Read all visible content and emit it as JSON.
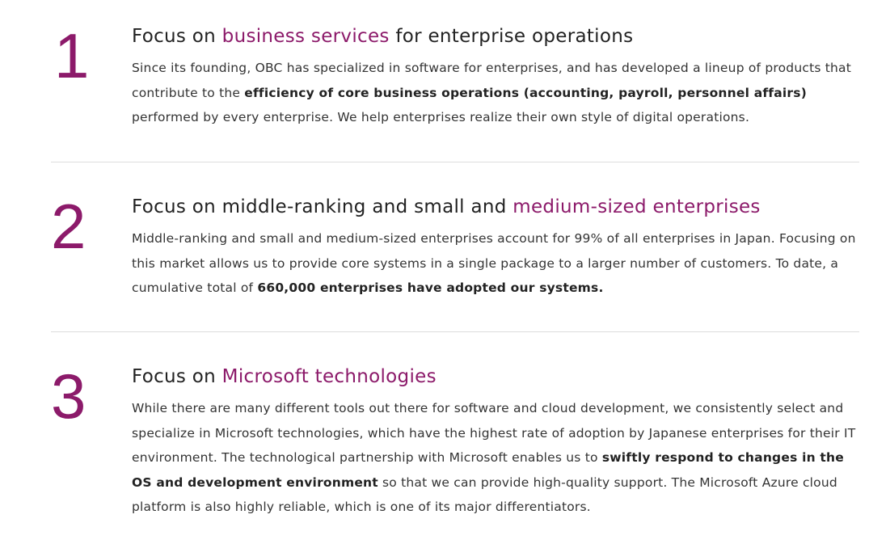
{
  "points": [
    {
      "number": "1",
      "title_pre": "Focus on ",
      "title_accent": "business services",
      "title_post": " for enterprise operations",
      "body_1": "Since its founding, OBC has specialized in software for enterprises, and has developed a lineup of products that contribute to the ",
      "body_bold_1": "efficiency of core business operations (accounting, payroll, personnel affairs)",
      "body_2": " performed by every enterprise. We help enterprises realize their own style of digital operations."
    },
    {
      "number": "2",
      "title_pre": "Focus on middle-ranking and small and ",
      "title_accent": "medium-sized enterprises",
      "body_1": "Middle-ranking and small and medium-sized enterprises account for 99% of all enterprises in Japan. Focusing on this market allows us to provide core systems in a single package to a larger number of customers. To date, a cumulative total of ",
      "body_bold_1": "660,000 enterprises have adopted our systems."
    },
    {
      "number": "3",
      "title_pre": "Focus on ",
      "title_accent": "Microsoft technologies",
      "body_1": "While there are many different tools out there for software and cloud development, we consistently select and specialize in Microsoft technologies, which have the highest rate of adoption by Japanese enterprises for their IT environment. The technological partnership with Microsoft enables us to ",
      "body_bold_1": "swiftly respond to changes in the OS and development environment",
      "body_2": " so that we can provide high-quality support. The Microsoft Azure cloud platform is also highly reliable, which is one of its major differentiators."
    }
  ],
  "colors": {
    "accent": "#8c1a6a",
    "text": "#333333",
    "divider": "#dddddd"
  }
}
